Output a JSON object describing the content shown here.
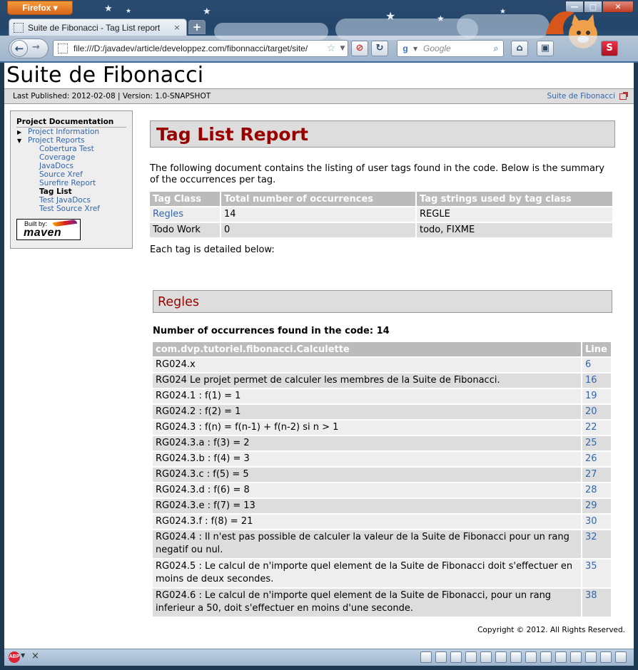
{
  "browser": {
    "menu_label": "Firefox ▾",
    "window_buttons": {
      "minimize": "—",
      "maximize": "□",
      "close": "✕"
    },
    "tab_title": "Suite de Fibonacci - Tag List report",
    "tab_close": "×",
    "new_tab": "+",
    "url": "file:///D:/javadev/article/developpez.com/fibonnacci/target/site/",
    "search_engine": "g",
    "search_placeholder": "Google",
    "accent": "#2a4b6e"
  },
  "header": {
    "title": "Suite de Fibonacci",
    "published": "Last Published: 2012-02-08  | Version: 1.0-SNAPSHOT",
    "project_link": "Suite de Fibonacci"
  },
  "sidebar": {
    "heading": "Project Documentation",
    "items": [
      {
        "label": "Project Information",
        "arrow": "▶"
      },
      {
        "label": "Project Reports",
        "arrow": "▼"
      }
    ],
    "reports": [
      {
        "label": "Cobertura Test"
      },
      {
        "label": "Coverage"
      },
      {
        "label": "JavaDocs"
      },
      {
        "label": "Source Xref"
      },
      {
        "label": "Surefire Report"
      },
      {
        "label": "Tag List",
        "current": true
      },
      {
        "label": "Test JavaDocs"
      },
      {
        "label": "Test Source Xref"
      }
    ],
    "built_by": "Built by:",
    "maven": "maven"
  },
  "main": {
    "heading": "Tag List Report",
    "intro": "The following document contains the listing of user tags found in the code. Below is the summary of the occurrences per tag.",
    "summary_headers": [
      "Tag Class",
      "Total number of occurrences",
      "Tag strings used by tag class"
    ],
    "summary_rows": [
      [
        "Regles",
        "14",
        "REGLE"
      ],
      [
        "Todo Work",
        "0",
        "todo, FIXME"
      ]
    ],
    "each_tag": "Each tag is detailed below:",
    "section_heading": "Regles",
    "count_text": "Number of occurrences found in the code: 14",
    "detail_headers": [
      "com.dvp.tutoriel.fibonacci.Calculette",
      "Line"
    ],
    "detail_rows": [
      [
        "RG024.x",
        "6"
      ],
      [
        "RG024 Le projet permet de calculer les membres de la Suite de Fibonacci.",
        "16"
      ],
      [
        "RG024.1 : f(1) = 1",
        "19"
      ],
      [
        "RG024.2 : f(2) = 1",
        "20"
      ],
      [
        "RG024.3 : f(n) = f(n-1) + f(n-2) si n > 1",
        "22"
      ],
      [
        "RG024.3.a : f(3) = 2",
        "25"
      ],
      [
        "RG024.3.b : f(4) = 3",
        "26"
      ],
      [
        "RG024.3.c : f(5) = 5",
        "27"
      ],
      [
        "RG024.3.d : f(6) = 8",
        "28"
      ],
      [
        "RG024.3.e : f(7) = 13",
        "29"
      ],
      [
        "RG024.3.f : f(8) = 21",
        "30"
      ],
      [
        "RG024.4 : Il n'est pas possible de calculer la valeur de la Suite de Fibonacci pour un rang negatif ou nul.",
        "32"
      ],
      [
        "RG024.5 : Le calcul de n'importe quel element de la Suite de Fibonacci doit s'effectuer en moins de deux secondes.",
        "35"
      ],
      [
        "RG024.6 : Le calcul de n'importe quel element de la Suite de Fibonacci, pour un rang inferieur a 50, doit s'effectuer en moins d'une seconde.",
        "38"
      ]
    ],
    "copyright": "Copyright © 2012. All Rights Reserved."
  },
  "statusbar": {
    "abp": "ABP",
    "close": "×",
    "icons": [
      "grid-icon",
      "snowflake-icon",
      "mail-icon",
      "noscript-icon",
      "page-icon",
      "pen-icon",
      "shield-icon",
      "bookmark-icon",
      "printer-icon",
      "refresh-icon",
      "notes-icon",
      "chart-icon",
      "tools-icon",
      "resize-icon"
    ]
  }
}
